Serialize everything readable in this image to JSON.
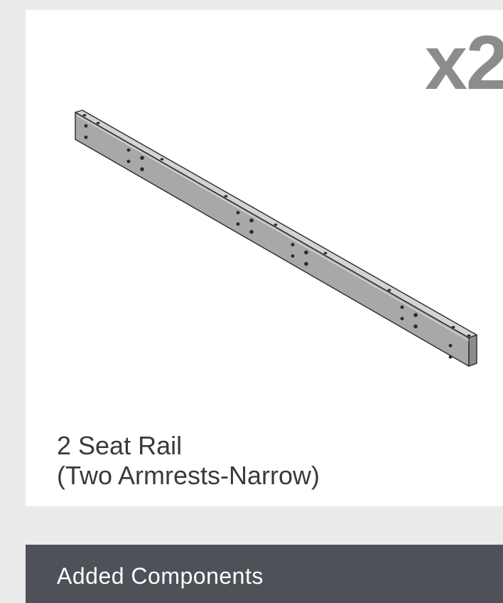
{
  "part_card": {
    "quantity_label": "x2",
    "name_line1": "2 Seat Rail",
    "name_line2": "(Two Armrests-Narrow)",
    "illustration_icon": "seat-rail-illustration"
  },
  "section": {
    "title": "Added Components"
  },
  "colors": {
    "page_background": "#ebebeb",
    "card_background": "#ffffff",
    "quantity_text": "#8c8c8c",
    "caption_text": "#3a3a3a",
    "section_bar": "#4e5157",
    "section_text": "#ffffff",
    "rail_top": "#d4d4d4",
    "rail_front": "#a8a8a8",
    "rail_outline": "#2a2a2a"
  }
}
